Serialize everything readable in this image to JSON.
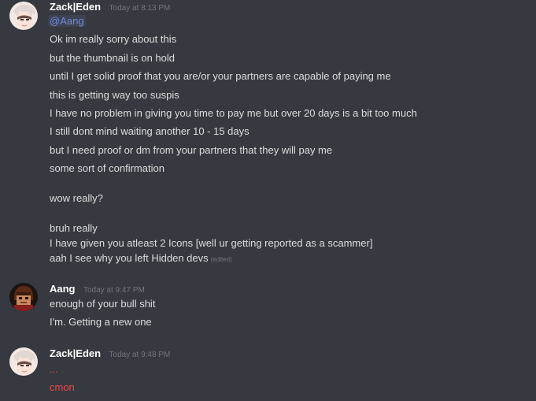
{
  "colors": {
    "background": "#36393f",
    "username": "#ffffff",
    "text": "#dcddde",
    "timestamp": "#72767d",
    "mention": "#7289da",
    "error_red": "#f04747"
  },
  "messages": [
    {
      "author": "Zack|Eden",
      "timestamp": "Today at 8:13 PM",
      "avatar_icon": "anime-avatar-icon",
      "lines": [
        "@Aang",
        "Ok im really sorry about this",
        "but the thumbnail is on hold",
        "until I get solid proof that you are/or your partners are capable of paying me",
        "this is getting way too suspis",
        "I have no problem in giving you time to pay me but over 20 days is a bit too much",
        "I still dont mind waiting another 10 - 15 days",
        "but I need proof or dm from your partners that they will pay me",
        "some sort of confirmation",
        "wow really?",
        "bruh really",
        "I have given you atleast 2 Icons  [well ur getting reported as a scammer]",
        "aah I see why you left Hidden devs"
      ],
      "edited_label": "(edited)"
    },
    {
      "author": "Aang",
      "timestamp": "Today at 9:47 PM",
      "avatar_icon": "character-avatar-icon",
      "lines": [
        "enough of your bull shit",
        "I'm. Getting a new one"
      ]
    },
    {
      "author": "Zack|Eden",
      "timestamp": "Today at 9:48 PM",
      "avatar_icon": "anime-avatar-icon",
      "lines": [
        "...",
        "cmon"
      ],
      "failed": true
    }
  ]
}
